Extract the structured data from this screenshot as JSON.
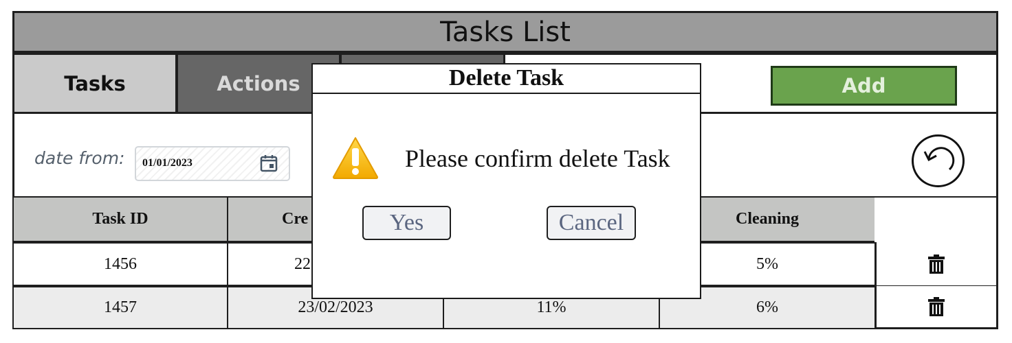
{
  "title": "Tasks List",
  "tabs": [
    {
      "label": "Tasks"
    },
    {
      "label": "Actions"
    },
    {
      "label": ""
    }
  ],
  "add_label": "Add",
  "filter": {
    "date_from_label": "date from:",
    "date_from_value": "01/01/2023"
  },
  "table": {
    "headers": [
      "Task ID",
      "Cre",
      "",
      "Cleaning"
    ],
    "rows": [
      {
        "task_id": "1456",
        "created": "22",
        "col3": "",
        "cleaning": "5%"
      },
      {
        "task_id": "1457",
        "created": "23/02/2023",
        "col3": "11%",
        "cleaning": "6%"
      }
    ]
  },
  "dialog": {
    "title": "Delete Task",
    "message": "Please confirm delete Task",
    "yes_label": "Yes",
    "cancel_label": "Cancel"
  },
  "colors": {
    "title_bar": "#9b9b9b",
    "tab_active": "#cacaca",
    "tab_inactive": "#666666",
    "add_button": "#6aa34d",
    "warning": "#f2b705"
  },
  "icons": {
    "date_picker": "calendar-icon",
    "refresh": "undo-icon",
    "row_delete": "trash-icon",
    "dialog": "warning-icon"
  }
}
